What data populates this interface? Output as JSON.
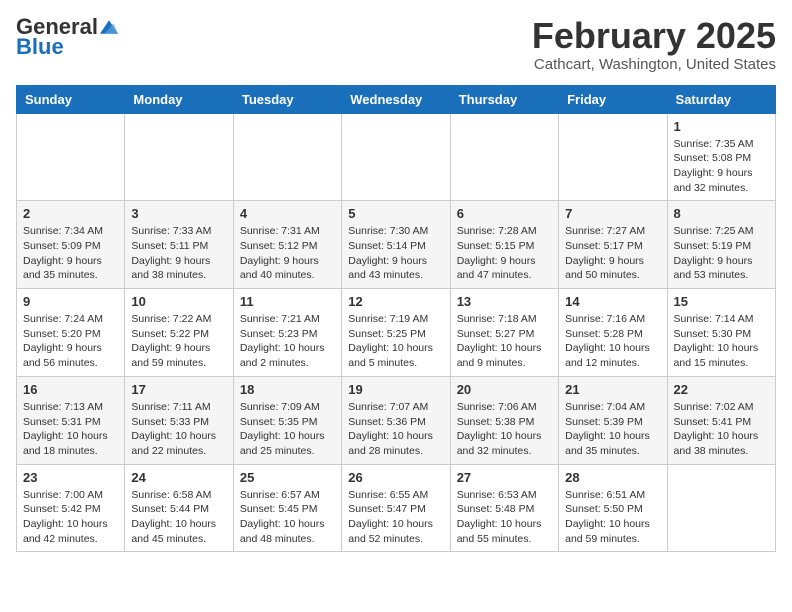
{
  "header": {
    "logo_general": "General",
    "logo_blue": "Blue",
    "month_title": "February 2025",
    "location": "Cathcart, Washington, United States"
  },
  "weekdays": [
    "Sunday",
    "Monday",
    "Tuesday",
    "Wednesday",
    "Thursday",
    "Friday",
    "Saturday"
  ],
  "weeks": [
    [
      {
        "day": "",
        "text": ""
      },
      {
        "day": "",
        "text": ""
      },
      {
        "day": "",
        "text": ""
      },
      {
        "day": "",
        "text": ""
      },
      {
        "day": "",
        "text": ""
      },
      {
        "day": "",
        "text": ""
      },
      {
        "day": "1",
        "text": "Sunrise: 7:35 AM\nSunset: 5:08 PM\nDaylight: 9 hours and 32 minutes."
      }
    ],
    [
      {
        "day": "2",
        "text": "Sunrise: 7:34 AM\nSunset: 5:09 PM\nDaylight: 9 hours and 35 minutes."
      },
      {
        "day": "3",
        "text": "Sunrise: 7:33 AM\nSunset: 5:11 PM\nDaylight: 9 hours and 38 minutes."
      },
      {
        "day": "4",
        "text": "Sunrise: 7:31 AM\nSunset: 5:12 PM\nDaylight: 9 hours and 40 minutes."
      },
      {
        "day": "5",
        "text": "Sunrise: 7:30 AM\nSunset: 5:14 PM\nDaylight: 9 hours and 43 minutes."
      },
      {
        "day": "6",
        "text": "Sunrise: 7:28 AM\nSunset: 5:15 PM\nDaylight: 9 hours and 47 minutes."
      },
      {
        "day": "7",
        "text": "Sunrise: 7:27 AM\nSunset: 5:17 PM\nDaylight: 9 hours and 50 minutes."
      },
      {
        "day": "8",
        "text": "Sunrise: 7:25 AM\nSunset: 5:19 PM\nDaylight: 9 hours and 53 minutes."
      }
    ],
    [
      {
        "day": "9",
        "text": "Sunrise: 7:24 AM\nSunset: 5:20 PM\nDaylight: 9 hours and 56 minutes."
      },
      {
        "day": "10",
        "text": "Sunrise: 7:22 AM\nSunset: 5:22 PM\nDaylight: 9 hours and 59 minutes."
      },
      {
        "day": "11",
        "text": "Sunrise: 7:21 AM\nSunset: 5:23 PM\nDaylight: 10 hours and 2 minutes."
      },
      {
        "day": "12",
        "text": "Sunrise: 7:19 AM\nSunset: 5:25 PM\nDaylight: 10 hours and 5 minutes."
      },
      {
        "day": "13",
        "text": "Sunrise: 7:18 AM\nSunset: 5:27 PM\nDaylight: 10 hours and 9 minutes."
      },
      {
        "day": "14",
        "text": "Sunrise: 7:16 AM\nSunset: 5:28 PM\nDaylight: 10 hours and 12 minutes."
      },
      {
        "day": "15",
        "text": "Sunrise: 7:14 AM\nSunset: 5:30 PM\nDaylight: 10 hours and 15 minutes."
      }
    ],
    [
      {
        "day": "16",
        "text": "Sunrise: 7:13 AM\nSunset: 5:31 PM\nDaylight: 10 hours and 18 minutes."
      },
      {
        "day": "17",
        "text": "Sunrise: 7:11 AM\nSunset: 5:33 PM\nDaylight: 10 hours and 22 minutes."
      },
      {
        "day": "18",
        "text": "Sunrise: 7:09 AM\nSunset: 5:35 PM\nDaylight: 10 hours and 25 minutes."
      },
      {
        "day": "19",
        "text": "Sunrise: 7:07 AM\nSunset: 5:36 PM\nDaylight: 10 hours and 28 minutes."
      },
      {
        "day": "20",
        "text": "Sunrise: 7:06 AM\nSunset: 5:38 PM\nDaylight: 10 hours and 32 minutes."
      },
      {
        "day": "21",
        "text": "Sunrise: 7:04 AM\nSunset: 5:39 PM\nDaylight: 10 hours and 35 minutes."
      },
      {
        "day": "22",
        "text": "Sunrise: 7:02 AM\nSunset: 5:41 PM\nDaylight: 10 hours and 38 minutes."
      }
    ],
    [
      {
        "day": "23",
        "text": "Sunrise: 7:00 AM\nSunset: 5:42 PM\nDaylight: 10 hours and 42 minutes."
      },
      {
        "day": "24",
        "text": "Sunrise: 6:58 AM\nSunset: 5:44 PM\nDaylight: 10 hours and 45 minutes."
      },
      {
        "day": "25",
        "text": "Sunrise: 6:57 AM\nSunset: 5:45 PM\nDaylight: 10 hours and 48 minutes."
      },
      {
        "day": "26",
        "text": "Sunrise: 6:55 AM\nSunset: 5:47 PM\nDaylight: 10 hours and 52 minutes."
      },
      {
        "day": "27",
        "text": "Sunrise: 6:53 AM\nSunset: 5:48 PM\nDaylight: 10 hours and 55 minutes."
      },
      {
        "day": "28",
        "text": "Sunrise: 6:51 AM\nSunset: 5:50 PM\nDaylight: 10 hours and 59 minutes."
      },
      {
        "day": "",
        "text": ""
      }
    ]
  ]
}
